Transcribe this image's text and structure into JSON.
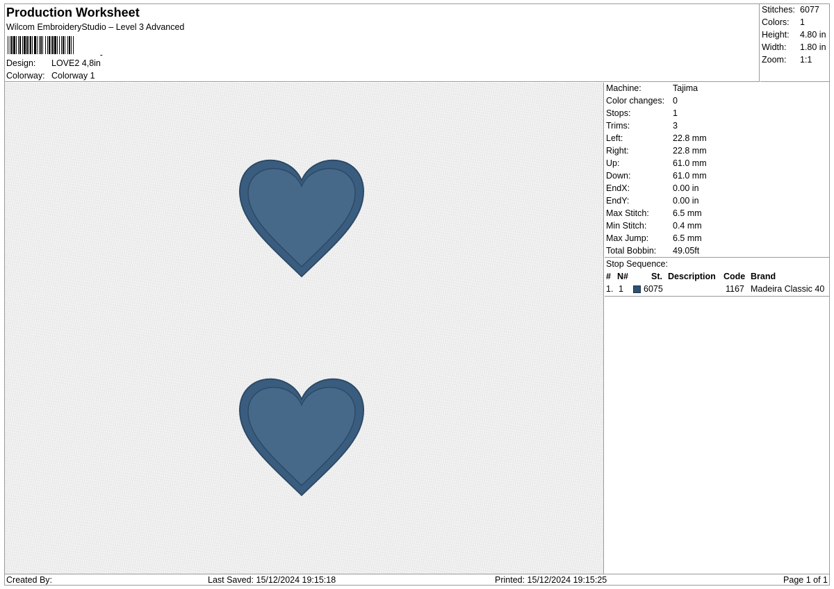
{
  "header": {
    "title": "Production Worksheet",
    "software": "Wilcom EmbroideryStudio – Level 3 Advanced",
    "design_label": "Design:",
    "design_value": "LOVE2  4,8in",
    "colorway_label": "Colorway:",
    "colorway_value": "Colorway 1"
  },
  "summary": [
    {
      "label": "Stitches:",
      "value": "6077"
    },
    {
      "label": "Colors:",
      "value": "1"
    },
    {
      "label": "Height:",
      "value": "4.80 in"
    },
    {
      "label": "Width:",
      "value": "1.80 in"
    },
    {
      "label": "Zoom:",
      "value": "1:1"
    }
  ],
  "machine_info": [
    {
      "label": "Machine:",
      "value": "Tajima"
    },
    {
      "label": "Color changes:",
      "value": "0"
    },
    {
      "label": "Stops:",
      "value": "1"
    },
    {
      "label": "Trims:",
      "value": "3"
    },
    {
      "label": "Left:",
      "value": "22.8 mm"
    },
    {
      "label": "Right:",
      "value": "22.8 mm"
    },
    {
      "label": "Up:",
      "value": "61.0 mm"
    },
    {
      "label": "Down:",
      "value": "61.0 mm"
    },
    {
      "label": "EndX:",
      "value": "0.00 in"
    },
    {
      "label": "EndY:",
      "value": "0.00 in"
    },
    {
      "label": "Max Stitch:",
      "value": "6.5 mm"
    },
    {
      "label": "Min Stitch:",
      "value": "0.4 mm"
    },
    {
      "label": "Max Jump:",
      "value": "6.5 mm"
    },
    {
      "label": "Total Bobbin:",
      "value": "49.05ft"
    }
  ],
  "stop_sequence": {
    "title": "Stop Sequence:",
    "columns": {
      "num": "#",
      "needle": "N#",
      "stitches": "St.",
      "description": "Description",
      "code": "Code",
      "brand": "Brand"
    },
    "rows": [
      {
        "num": "1.",
        "needle": "1",
        "color": "#2f5173",
        "stitches": "6075",
        "description": "",
        "code": "1167",
        "brand": "Madeira Classic 40"
      }
    ]
  },
  "colors": {
    "thread": "#46698a",
    "thread_dark": "#2c4a66",
    "thread_border": "#3a5d7f"
  },
  "footer": {
    "created_by": "Created By:",
    "last_saved": "Last Saved: 15/12/2024 19:15:18",
    "printed": "Printed: 15/12/2024 19:15:25",
    "page": "Page 1 of 1"
  }
}
